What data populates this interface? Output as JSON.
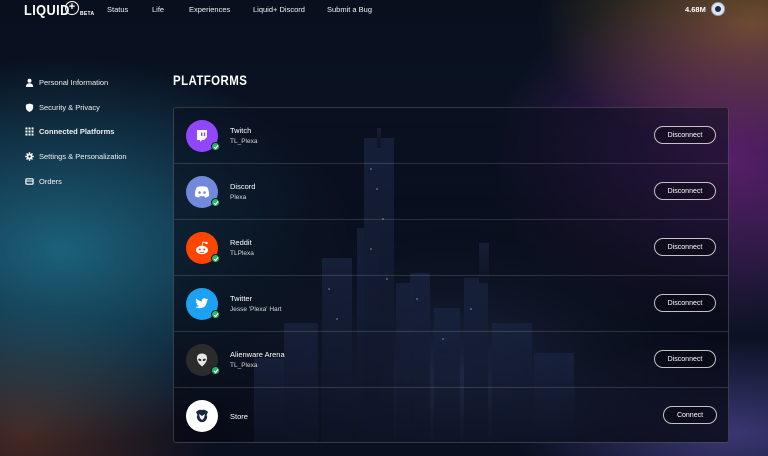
{
  "brand": {
    "logo": "LIQUID",
    "logo_plus": "+",
    "badge": "BETA"
  },
  "nav": [
    {
      "label": "Status"
    },
    {
      "label": "Life"
    },
    {
      "label": "Experiences"
    },
    {
      "label": "Liquid+ Discord"
    },
    {
      "label": "Submit a Bug"
    }
  ],
  "balance": "4.68M",
  "sidebar": {
    "items": [
      {
        "label": "Personal Information",
        "icon": "person-icon"
      },
      {
        "label": "Security & Privacy",
        "icon": "shield-icon"
      },
      {
        "label": "Connected Platforms",
        "icon": "grid-icon",
        "active": true
      },
      {
        "label": "Settings & Personalization",
        "icon": "gear-icon"
      },
      {
        "label": "Orders",
        "icon": "cart-icon"
      }
    ]
  },
  "main": {
    "title": "PLATFORMS",
    "platforms": [
      {
        "name": "Twitch",
        "username": "TL_Plexa",
        "action": "Disconnect",
        "connected": true,
        "color": "#9146ff",
        "icon": "twitch-icon"
      },
      {
        "name": "Discord",
        "username": "Plexa",
        "action": "Disconnect",
        "connected": true,
        "color": "#7289da",
        "icon": "discord-icon"
      },
      {
        "name": "Reddit",
        "username": "TLPlexa",
        "action": "Disconnect",
        "connected": true,
        "color": "#ff4500",
        "icon": "reddit-icon"
      },
      {
        "name": "Twitter",
        "username": "Jesse 'Plexa' Hart",
        "action": "Disconnect",
        "connected": true,
        "color": "#1da1f2",
        "icon": "twitter-icon"
      },
      {
        "name": "Alienware Arena",
        "username": "TL_Plexa",
        "action": "Disconnect",
        "connected": true,
        "color": "#2b2b2b",
        "icon": "alienware-icon"
      },
      {
        "name": "Store",
        "username": "",
        "action": "Connect",
        "connected": false,
        "color": "#ffffff",
        "icon": "store-icon"
      }
    ]
  },
  "colors": {
    "accent": "#25b86a",
    "background": "#0c1528"
  }
}
